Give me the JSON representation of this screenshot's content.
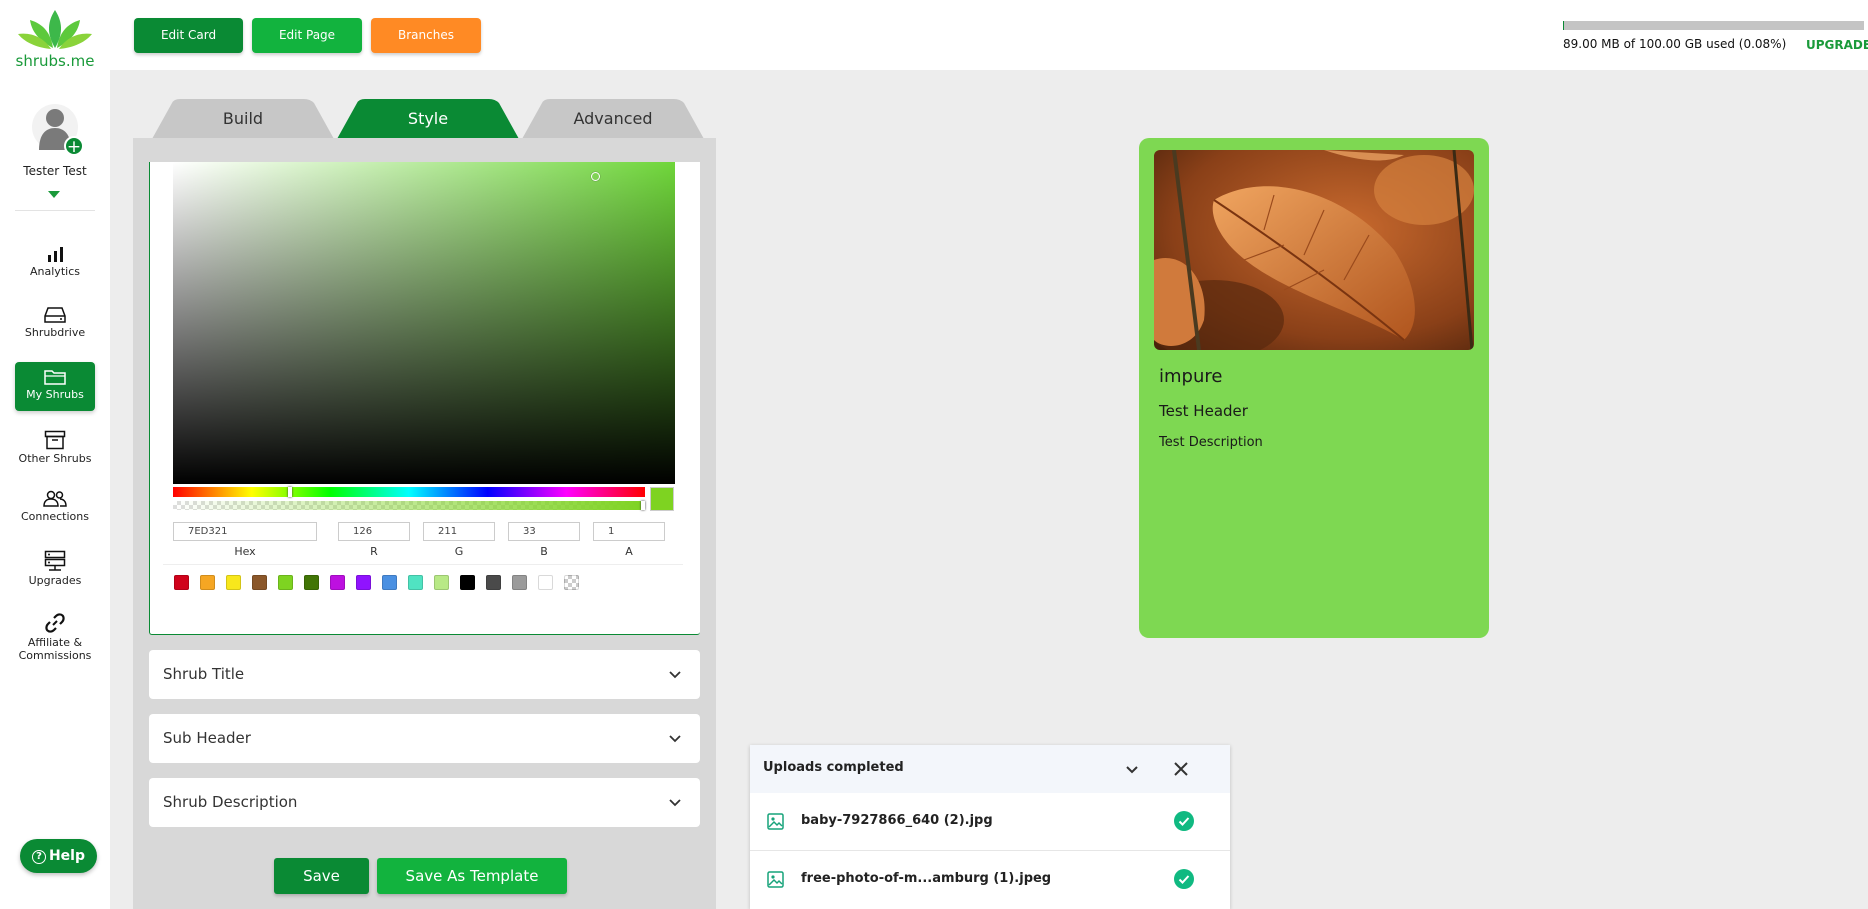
{
  "brand": {
    "name": "shrubs.me",
    "accent": "#0a8a34",
    "accent_light": "#12b33e",
    "orange": "#ff8a24"
  },
  "user": {
    "name": "Tester Test"
  },
  "sidebar": {
    "items": [
      {
        "label": "Analytics",
        "icon": "bar-chart-icon"
      },
      {
        "label": "Shrubdrive",
        "icon": "drive-icon"
      },
      {
        "label": "My Shrubs",
        "icon": "folder-icon",
        "active": true
      },
      {
        "label": "Other Shrubs",
        "icon": "archive-icon"
      },
      {
        "label": "Connections",
        "icon": "users-icon"
      },
      {
        "label": "Upgrades",
        "icon": "server-icon"
      },
      {
        "label": "Affiliate &",
        "label2": "Commissions",
        "icon": "link-icon"
      }
    ],
    "help": "Help"
  },
  "topbar": {
    "edit_card": "Edit Card",
    "edit_page": "Edit Page",
    "branches": "Branches",
    "storage_text": "89.00 MB of 100.00 GB used (0.08%)",
    "storage_fraction": 0.0008,
    "upgrade": "UPGRADE"
  },
  "tabs": [
    {
      "label": "Build"
    },
    {
      "label": "Style",
      "active": true
    },
    {
      "label": "Advanced"
    }
  ],
  "color_picker": {
    "hex": "7ED321",
    "r": "126",
    "g": "211",
    "b": "33",
    "a": "1",
    "labels": {
      "hex": "Hex",
      "r": "R",
      "g": "G",
      "b": "B",
      "a": "A"
    },
    "current_color": "#7ed321",
    "swatches": [
      "#d0021b",
      "#f5a623",
      "#f8e71c",
      "#8b572a",
      "#7ed321",
      "#417505",
      "#bd10e0",
      "#9013fe",
      "#4a90e2",
      "#50e3c2",
      "#b8e986",
      "#000000",
      "#4a4a4a",
      "#9b9b9b",
      "#ffffff",
      "transparent"
    ]
  },
  "sections": {
    "title": "Shrub Title",
    "sub_header": "Sub Header",
    "description": "Shrub Description"
  },
  "actions": {
    "save": "Save",
    "save_template": "Save As Template"
  },
  "preview": {
    "title": "impure",
    "header": "Test Header",
    "description": "Test Description",
    "background": "#7ed852"
  },
  "uploads": {
    "title": "Uploads completed",
    "files": [
      {
        "name": "baby-7927866_640 (2).jpg",
        "status": "completed"
      },
      {
        "name": "free-photo-of-m...amburg (1).jpeg",
        "status": "completed"
      }
    ]
  }
}
